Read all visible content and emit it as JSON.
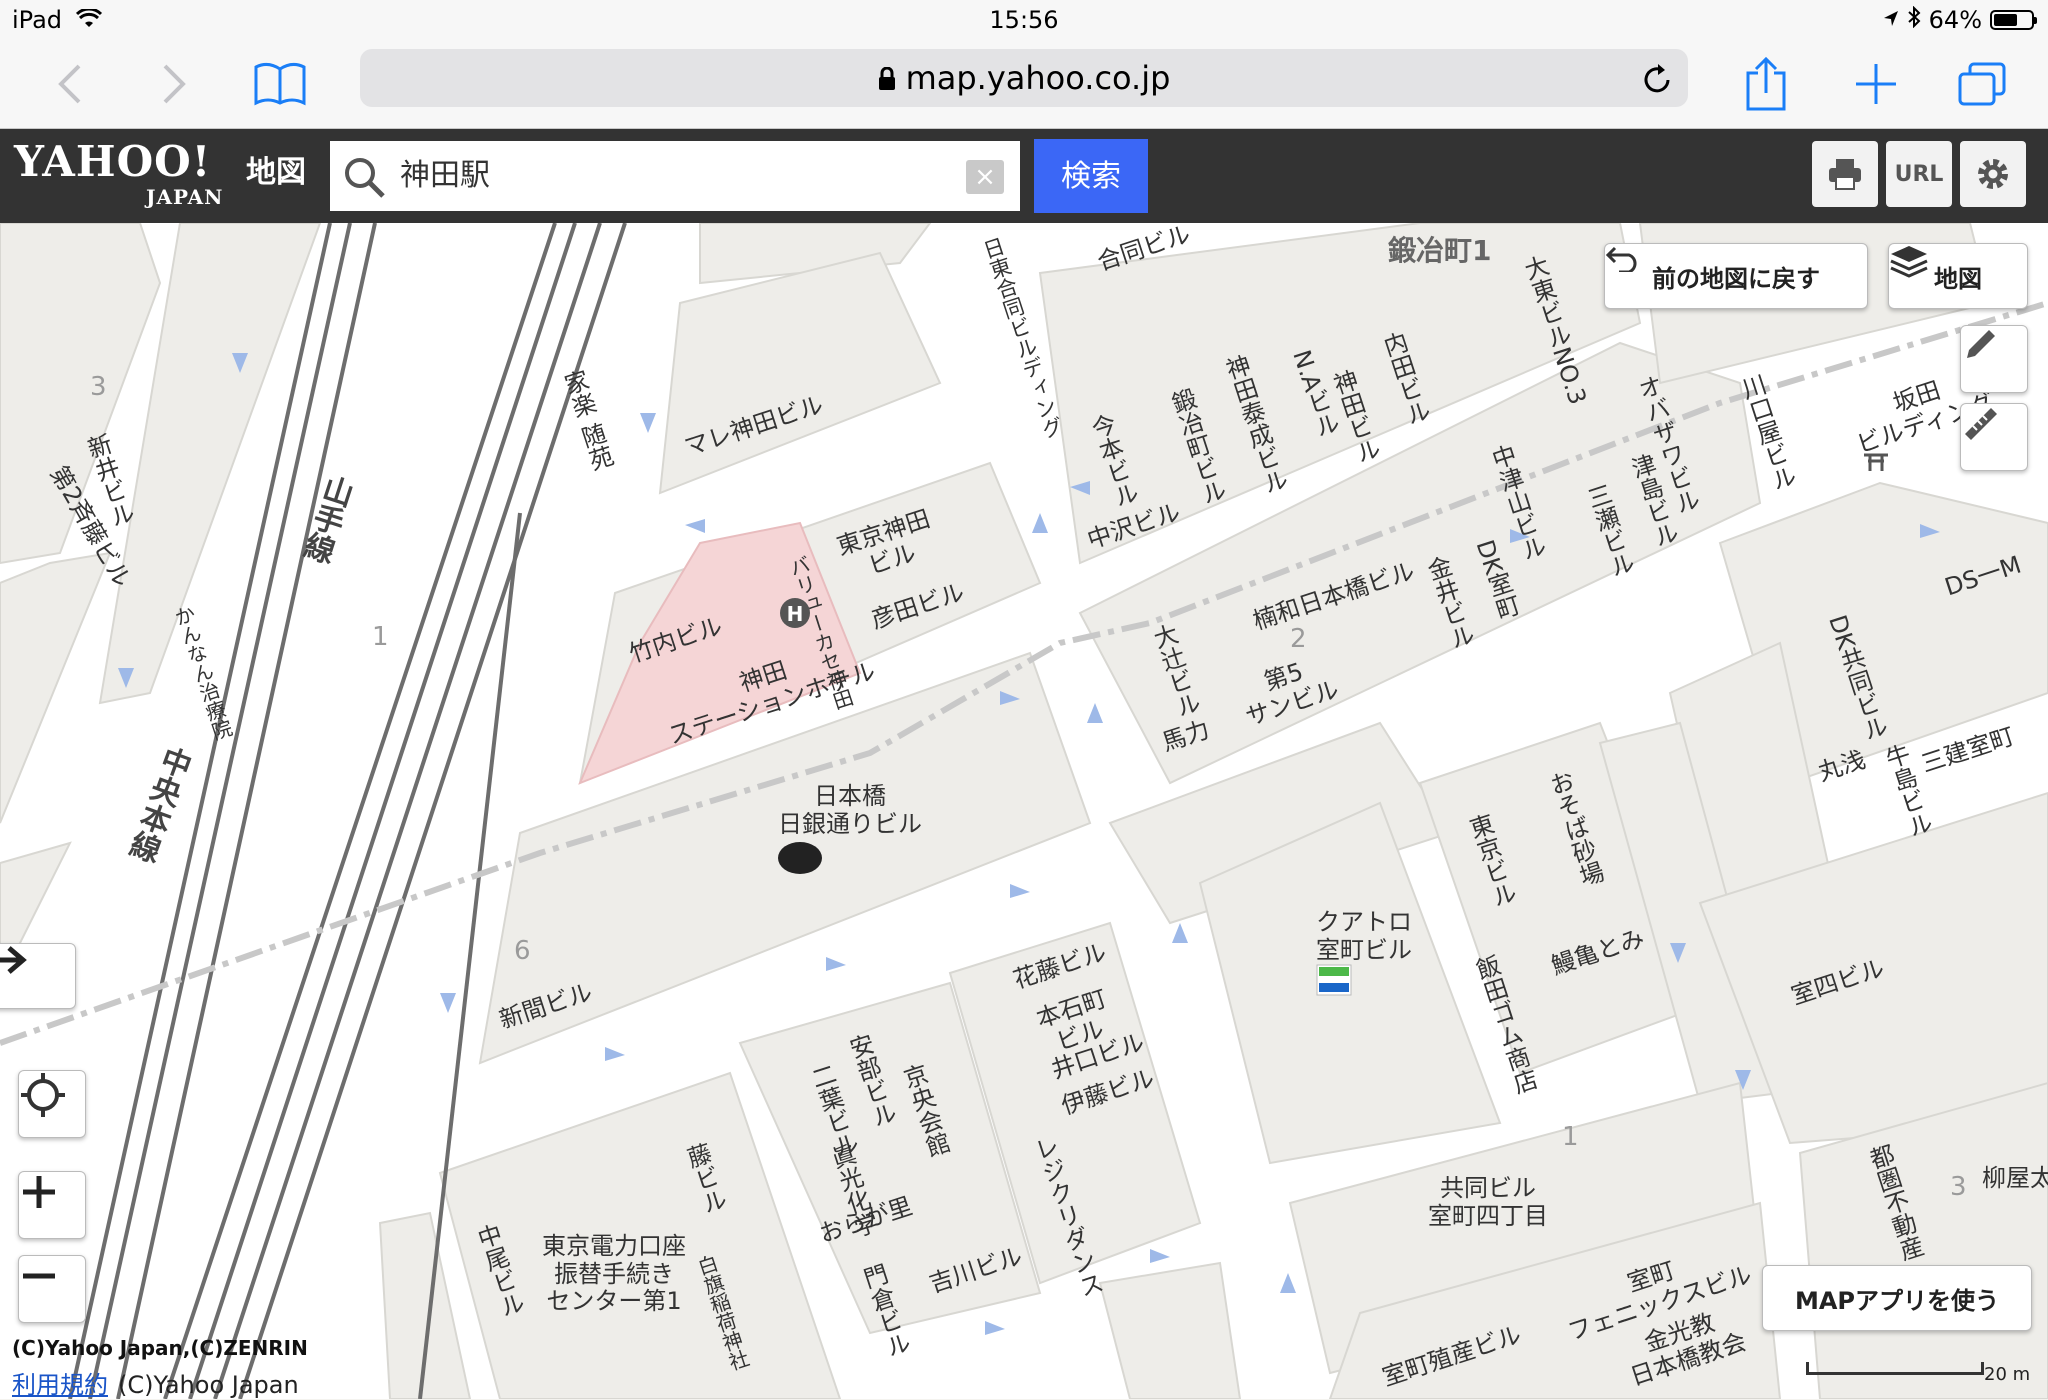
{
  "status_bar": {
    "device": "iPad",
    "time": "15:56",
    "battery": "64%",
    "battery_level": 0.64
  },
  "browser": {
    "url": "map.yahoo.co.jp"
  },
  "header": {
    "logo": "YAHOO!",
    "logo_sub": "JAPAN",
    "service": "地図",
    "search_value": "神田駅",
    "search_button": "検索",
    "print_icon": "printer-icon",
    "url_button": "URL",
    "settings_icon": "gear-icon"
  },
  "map_controls": {
    "back_to_previous": "前の地図に戻す",
    "layer_button": "地図",
    "map_app_button": "MAPアプリを使う",
    "scale_label": "20 m"
  },
  "attribution": {
    "copyright_1": "(C)Yahoo Japan,(C)ZENRIN",
    "terms_link": "利用規約",
    "copyright_2": "(C)Yahoo Japan"
  },
  "map_labels": {
    "kajicho": "鍛冶町1",
    "yamanote": "山手線",
    "chuo": "中央本線",
    "kanda_station_hotel": "神田\nステーションホテル",
    "nichigin": "日本橋\n日銀通りビル",
    "quatro": "クアトロ\n室町ビル",
    "tokyo_kanda_bldg": "東京神田\nビル",
    "takeuchi": "竹内ビル",
    "hikota": "彦田ビル",
    "value_kanda": "バリューカセ神田",
    "marekanda": "マレ神田ビル",
    "nanwa": "楠和日本橋ビル",
    "dai5": "第5\nサンビル",
    "bariki": "馬力",
    "ootsuji": "大辻ビル",
    "kanai": "金井ビル",
    "dk_muro": "DK室町",
    "nakatsuyama": "中津山ビル",
    "mikawa": "三瀬ビル",
    "tsushima": "津島ビル",
    "obazawa": "オバザワビル",
    "kawaguchiya": "川口屋ビル",
    "sakata": "坂田\nビルディング",
    "imamoto": "今本ビル",
    "nakazawa": "中沢ビル",
    "kajimachi_bldg": "鍛冶町ビル",
    "kanda_taisei": "神田泰成ビル",
    "na_bldg": "N.Aビル",
    "kanda_bldg": "神田ビル",
    "uchida": "内田ビル",
    "daito": "大東ビルNO.3",
    "nitto": "日東合同ビルディング",
    "goudou": "合同ビル",
    "shinbun": "新間ビル",
    "hanafuji": "花藤ビル",
    "hongoku": "本石町\nビル",
    "iguchi": "井口ビル",
    "ito": "伊藤ビル",
    "regicrest": "レジクリダンス",
    "abe": "安部ビル",
    "futaba": "二葉ビル",
    "kyoo": "京央会館",
    "shinko": "眞光化学",
    "oragasato": "おらが里",
    "yoshikawa": "吉川ビル",
    "monkura": "門倉ビル",
    "fuji": "藤ビル",
    "tepco": "東京電力口座\n振替手続き\nセンター第1",
    "nakao": "中尾ビル",
    "shirahata": "白旗稲荷神社",
    "tokyo_bldg": "東京ビル",
    "osoba": "おそば砂場",
    "unagi": "鰻亀とみ",
    "iida": "飯田ゴム商店",
    "kyodo": "共同ビル\n室町四丁目",
    "muromachi_phoenix": "室町\nフェニックスビル",
    "kinko": "金光教\n日本橋教会",
    "muro_hanjo": "室町殖産ビル",
    "dk_kyodo": "DK共同ビル",
    "maruasa": "丸浅",
    "ushijima": "牛島ビル",
    "sanken": "三建室町",
    "ds_m": "DS一M",
    "muro4": "室四ビル",
    "toudai": "都圏不動産",
    "yanagiya": "柳屋太",
    "kaseki": "家楽 随苑",
    "kanka": "かんなん治療院",
    "shinsai": "新井ビル",
    "saito": "第2斉藤ビル",
    "bld3": "3",
    "bld1": "1",
    "bld2": "2",
    "bld6": "6"
  }
}
